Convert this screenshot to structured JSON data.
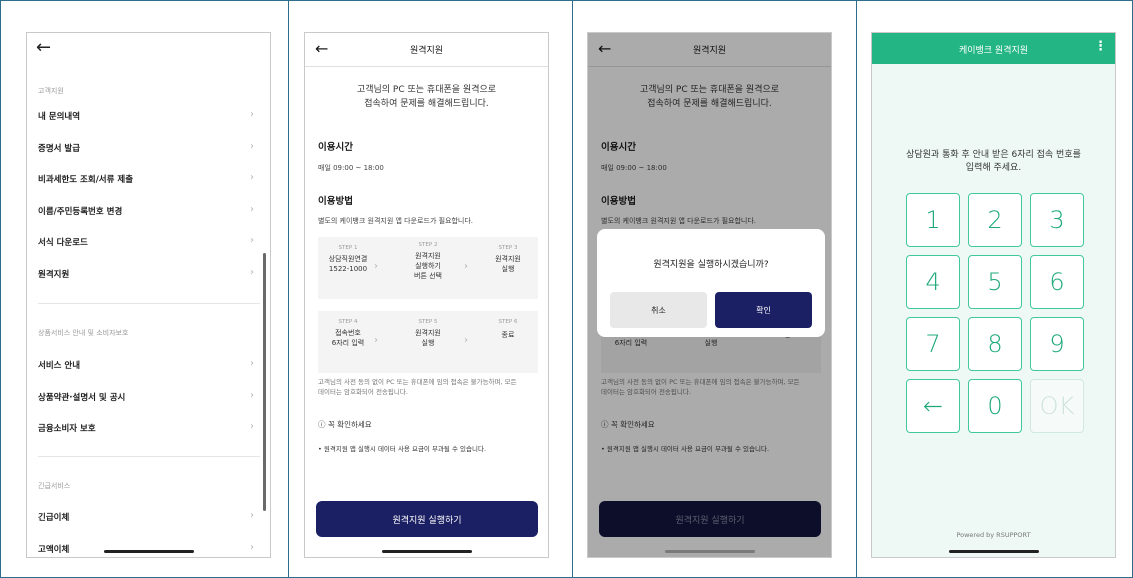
{
  "screen1": {
    "back_glyph": "←",
    "section1_label": "고객지원",
    "section1_items": [
      "내 문의내역",
      "증명서 발급",
      "비과세한도 조회/서류 제출",
      "이름/주민등록번호 변경",
      "서식 다운로드",
      "원격지원"
    ],
    "section2_label": "상품서비스 안내 및 소비자보호",
    "section2_items": [
      "서비스 안내",
      "상품약관·설명서 및 공시",
      "금융소비자 보호"
    ],
    "section3_label": "긴급서비스",
    "section3_items": [
      "긴급이체",
      "고액이체"
    ],
    "chevron": "›"
  },
  "remote": {
    "title": "원격지원",
    "intro_line1": "고객님의 PC 또는 휴대폰을 원격으로",
    "intro_line2": "접속하여 문제를 해결해드립니다.",
    "hours_label": "이용시간",
    "hours_value": "매일 09:00 ~ 18:00",
    "method_label": "이용방법",
    "method_desc": "별도의 케이뱅크 원격지원 앱 다운로드가 필요합니다.",
    "steps_row1": [
      {
        "num": "STEP 1",
        "line1": "상담직원연결",
        "line2": "1522-1000",
        "line3": ""
      },
      {
        "num": "STEP 2",
        "line1": "원격지원",
        "line2": "실행하기",
        "line3": "버튼 선택"
      },
      {
        "num": "STEP 3",
        "line1": "원격지원",
        "line2": "실행",
        "line3": ""
      }
    ],
    "steps_row2": [
      {
        "num": "STEP 4",
        "line1": "접속번호",
        "line2": "6자리 입력",
        "line3": ""
      },
      {
        "num": "STEP 5",
        "line1": "원격지원",
        "line2": "실행",
        "line3": ""
      },
      {
        "num": "STEP 6",
        "line1": "종료",
        "line2": "",
        "line3": ""
      }
    ],
    "notice_line1": "고객님의 사전 동의 없이 PC 또는 휴대폰에 임의 접속은 불가능하며, 모든",
    "notice_line2": "데이터는 암호화되어 전송됩니다.",
    "check_title": "ⓘ 꼭 확인하세요",
    "bullet": "• 원격지원 앱 실행시 데이터 사용 요금이 부과될 수 있습니다.",
    "run_button": "원격지원 실행하기"
  },
  "dialog": {
    "message": "원격지원을 실행하시겠습니까?",
    "cancel": "취소",
    "confirm": "확인"
  },
  "keypad": {
    "title": "케이뱅크 원격지원",
    "menu_glyph": "⋮",
    "instr_line1": "상담원과 통화 후 안내 받은 6자리 접속 번호를",
    "instr_line2": "입력해 주세요.",
    "keys": [
      "1",
      "2",
      "3",
      "4",
      "5",
      "6",
      "7",
      "8",
      "9",
      "←",
      "0",
      "OK"
    ],
    "powered_by": "Powered by RSUPPORT"
  },
  "colors": {
    "navy": "#1b1f63",
    "green": "#24b584",
    "frame_border": "#2e6e8a"
  }
}
